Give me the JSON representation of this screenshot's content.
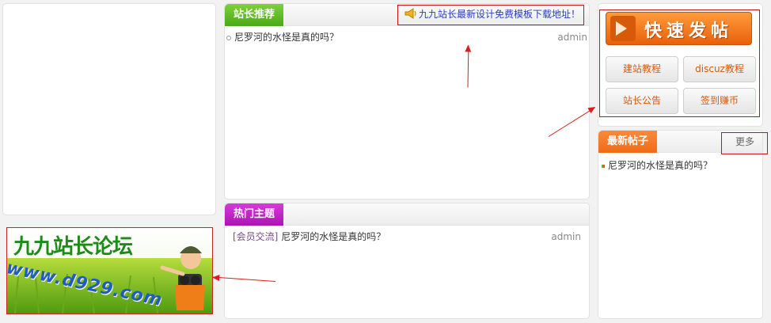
{
  "notice": {
    "text": "九九站长最新设计免费模板下载地址！"
  },
  "panels": {
    "recommend": {
      "tab": "站长推荐",
      "items": [
        {
          "title": "尼罗河的水怪是真的吗？",
          "author": "admin"
        }
      ]
    },
    "hot": {
      "tab": "热门主题",
      "items": [
        {
          "category": "[会员交流]",
          "title": "尼罗河的水怪是真的吗？",
          "author": "admin"
        }
      ]
    },
    "latest": {
      "tab": "最新帖子",
      "more": "更多",
      "items": [
        {
          "title": "尼罗河的水怪是真的吗？"
        }
      ]
    }
  },
  "quick_post": {
    "label": "快速发帖",
    "buttons": [
      "建站教程",
      "discuz教程",
      "站长公告",
      "签到赚币"
    ]
  },
  "banner": {
    "title": "九九站长论坛",
    "url_text": "www.d929.com"
  },
  "colors": {
    "green_tab": "#5cb824",
    "purple_tab": "#c020c6",
    "orange_tab": "#f57a28",
    "annotation_red": "#cc1111"
  }
}
